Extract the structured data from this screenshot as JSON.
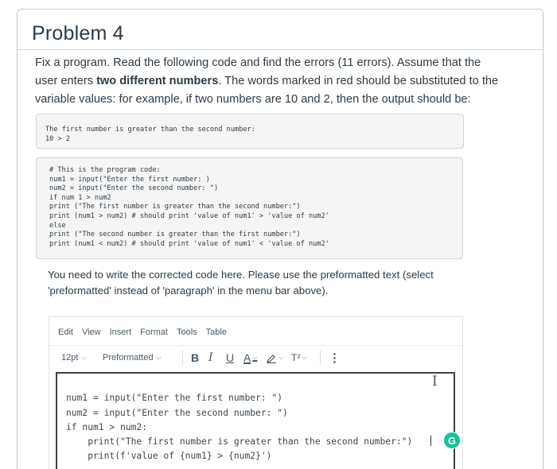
{
  "problem": {
    "title": "Problem 4",
    "para_lines": [
      {
        "bold": "",
        "text": "Fix a program. Read the following code and find the errors (11 errors). Assume that the"
      },
      {
        "pre": "user enters ",
        "bold": "two different numbers",
        "post": ". The words marked in red should be substituted to the"
      },
      {
        "text": "variable values: for example, if two numbers are 10 and 2, then the output should be:"
      }
    ]
  },
  "example_output": [
    "The first number is greater than the second number:",
    "10 > 2"
  ],
  "given_code": [
    "# This is the program code:",
    "num1 = input(\"Enter the first number: )",
    "num2 = input(\"Enter the second number: \")",
    "if num 1 > num2",
    "print (\"The first number is greater than the second number:\")",
    "print (num1 > num2) # should print 'value of num1' > 'value of num2'",
    "else",
    "print (\"The second number is greater than the first number:\")",
    "print (num1 < num2) # should print 'value of num1' < 'value of num2'"
  ],
  "instructions": [
    "You need to write the corrected code here. Please use the preformatted text (select",
    "'preformatted' instead of 'paragraph' in the menu bar above)."
  ],
  "editor": {
    "menu": [
      "Edit",
      "View",
      "Insert",
      "Format",
      "Tools",
      "Table"
    ],
    "font_size": "12pt",
    "block_format": "Preformatted",
    "toolbar_icons": [
      "bold-icon",
      "italic-icon",
      "underline-icon",
      "text-color-icon",
      "highlight-color-icon",
      "superscript-icon",
      "more-icon"
    ],
    "labels": {
      "bold": "B",
      "italic": "I",
      "underline": "U",
      "text_color": "A",
      "superscript": "T²",
      "more": "⋮"
    },
    "code_lines": [
      "num1 = input(\"Enter the first number: \")",
      "num2 = input(\"Enter the second number: \")",
      "if num1 > num2:",
      "    print(\"The first number is greater than the second number:\")",
      "    print(f'value of {num1} > {num2}')"
    ],
    "grammarly_label": "G",
    "cursor_glyph": "I"
  },
  "colors": {
    "text": "#2d3b45",
    "border": "#c7cdd1",
    "pre_bg": "#f5f5f5",
    "grammarly": "#15c39a",
    "spell_error": "#d9534f"
  }
}
